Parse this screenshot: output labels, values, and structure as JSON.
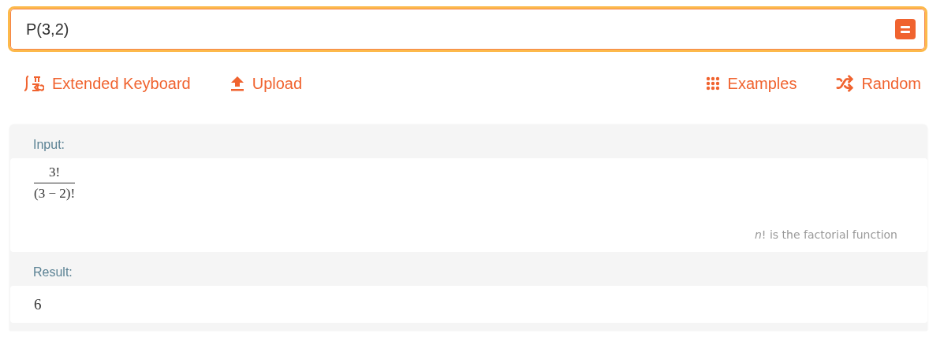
{
  "query": {
    "value": "P(3,2)"
  },
  "toolbar": {
    "left": [
      {
        "kind": "keyboard",
        "label": "Extended Keyboard"
      },
      {
        "kind": "upload",
        "label": "Upload"
      }
    ],
    "right": [
      {
        "kind": "examples",
        "label": "Examples"
      },
      {
        "kind": "random",
        "label": "Random"
      }
    ]
  },
  "pods": [
    {
      "kind": "fraction",
      "title": "Input:",
      "numerator": "3!",
      "denominator": "(3 − 2)!",
      "note": "*n*! is the factorial function"
    },
    {
      "kind": "plain",
      "title": "Result:",
      "value": "6"
    }
  ]
}
